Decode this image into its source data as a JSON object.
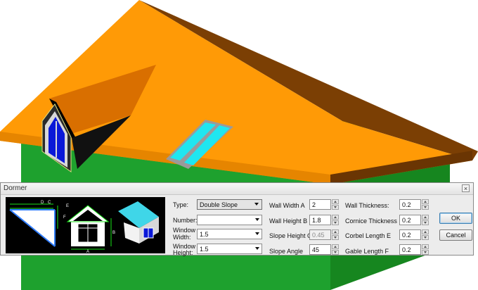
{
  "dialog": {
    "title": "Dormer",
    "close_glyph": "×"
  },
  "fields": {
    "type": {
      "label": "Type:",
      "value": "Double Slope"
    },
    "number": {
      "label": "Number:",
      "value": ""
    },
    "window_width": {
      "label_line1": "Window",
      "label_line2": "Width:",
      "value": "1.5"
    },
    "window_height": {
      "label_line1": "Window",
      "label_line2": "Height:",
      "value": "1.5"
    },
    "wall_width_a": {
      "label": "Wall Width A",
      "value": "2"
    },
    "wall_height_b": {
      "label": "Wall Height B",
      "value": "1.8"
    },
    "slope_height_c": {
      "label": "Slope Height C",
      "value": "0.45",
      "disabled": true
    },
    "slope_angle": {
      "label": "Slope Angle",
      "value": "45"
    },
    "wall_thickness": {
      "label": "Wall Thickness:",
      "value": "0.2"
    },
    "cornice_thickness_d": {
      "label": "Cornice Thickness D",
      "value": "0.2"
    },
    "corbel_length_e": {
      "label": "Corbel Length E",
      "value": "0.2"
    },
    "gable_length_f": {
      "label": "Gable Length F",
      "value": "0.2"
    }
  },
  "buttons": {
    "ok": "OK",
    "cancel": "Cancel"
  },
  "preview": {
    "dimension_letters": [
      "A",
      "B",
      "C",
      "D",
      "E",
      "F"
    ]
  },
  "colors": {
    "roof_top": "#ff9a06",
    "roof_side": "#7b3f04",
    "wall_green": "#1a9c2a",
    "skylight": "#20e6f0",
    "window_blue": "#0a18d8",
    "preview_cyan": "#3fd6e8"
  }
}
